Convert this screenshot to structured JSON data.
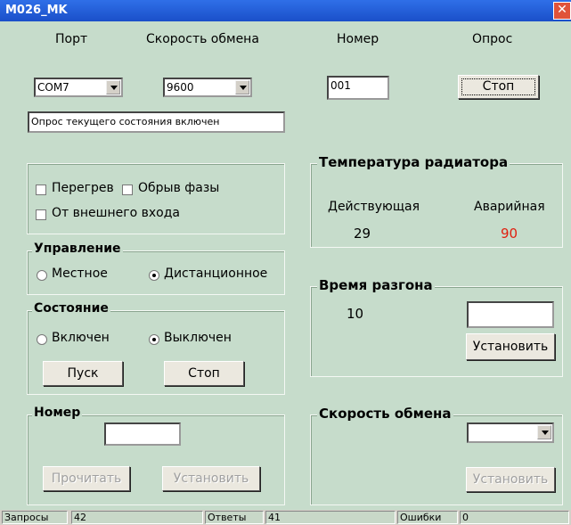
{
  "window": {
    "title": "M026_MK",
    "close_glyph": "✕"
  },
  "connection": {
    "port_label": "Порт",
    "port_value": "COM7",
    "baud_label": "Скорость обмена",
    "baud_value": "9600",
    "number_label": "Номер",
    "number_value": "001",
    "poll_label": "Опрос",
    "poll_button": "Стоп"
  },
  "status_message": "Опрос текущего состояния включен",
  "alarms": {
    "overheat": "Перегрев",
    "phase_break": "Обрыв фазы",
    "external_input": "От внешнего входа"
  },
  "control": {
    "title": "Управление",
    "local": "Местное",
    "remote": "Дистанционное",
    "selected": "remote"
  },
  "state": {
    "title": "Состояние",
    "on": "Включен",
    "off": "Выключен",
    "selected": "off",
    "start_button": "Пуск",
    "stop_button": "Стоп"
  },
  "number_group": {
    "title": "Номер",
    "value": "",
    "read_button": "Прочитать",
    "set_button": "Установить"
  },
  "radiator_temp": {
    "title": "Температура радиатора",
    "actual_label": "Действующая",
    "alarm_label": "Аварийная",
    "actual_value": "29",
    "alarm_value": "90",
    "alarm_color": "#e02010"
  },
  "accel_time": {
    "title": "Время разгона",
    "value": "10",
    "input_value": "",
    "set_button": "Установить"
  },
  "baud_group": {
    "title": "Скорость обмена",
    "value": "",
    "set_button": "Установить"
  },
  "statusbar": {
    "requests_label": "Запросы",
    "requests_value": "42",
    "responses_label": "Ответы",
    "responses_value": "41",
    "errors_label": "Ошибки",
    "errors_value": "0"
  }
}
